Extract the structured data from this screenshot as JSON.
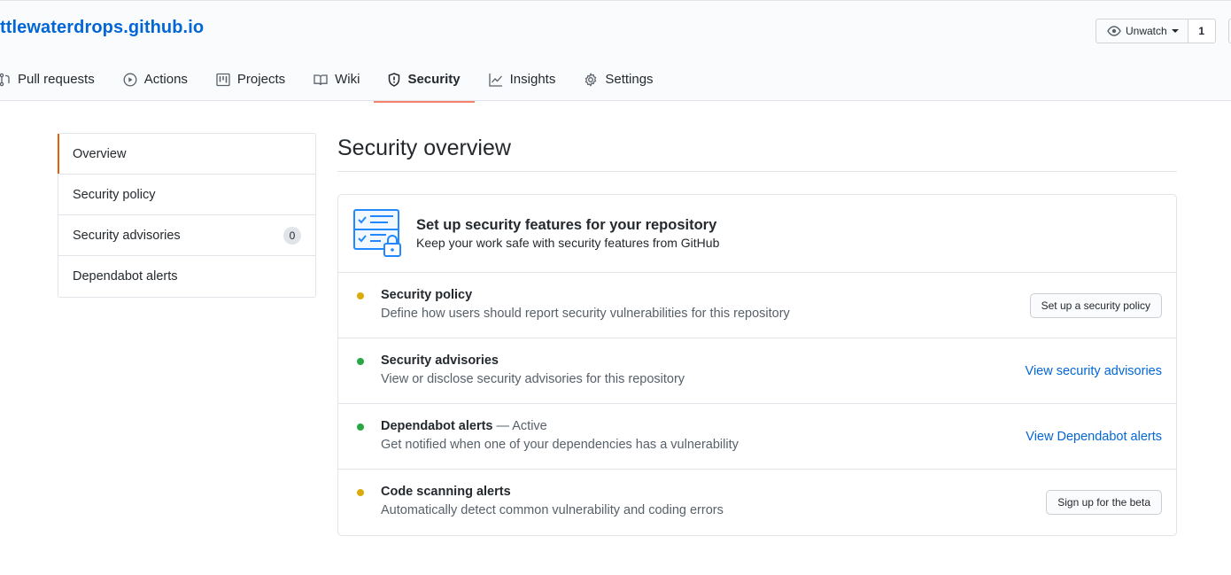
{
  "repo": {
    "title": "ttlewaterdrops.github.io"
  },
  "watch": {
    "label": "Unwatch",
    "count": "1"
  },
  "tabs": [
    {
      "label": "Pull requests",
      "icon": "pull-request-icon"
    },
    {
      "label": "Actions",
      "icon": "play-icon"
    },
    {
      "label": "Projects",
      "icon": "project-icon"
    },
    {
      "label": "Wiki",
      "icon": "book-icon"
    },
    {
      "label": "Security",
      "icon": "shield-icon",
      "selected": true
    },
    {
      "label": "Insights",
      "icon": "graph-icon"
    },
    {
      "label": "Settings",
      "icon": "gear-icon"
    }
  ],
  "sidebar": {
    "items": [
      {
        "label": "Overview",
        "selected": true
      },
      {
        "label": "Security policy"
      },
      {
        "label": "Security advisories",
        "count": "0"
      },
      {
        "label": "Dependabot alerts"
      }
    ]
  },
  "main": {
    "title": "Security overview",
    "card": {
      "heading": "Set up security features for your repository",
      "subheading": "Keep your work safe with security features from GitHub",
      "rows": [
        {
          "title": "Security policy",
          "status": "",
          "description": "Define how users should report security vulnerabilities for this repository",
          "dot_color": "#dbab09",
          "action": "Set up a security policy",
          "action_type": "button"
        },
        {
          "title": "Security advisories",
          "status": "",
          "description": "View or disclose security advisories for this repository",
          "dot_color": "#28a745",
          "action": "View security advisories",
          "action_type": "link"
        },
        {
          "title": "Dependabot alerts",
          "status": " — Active",
          "description": "Get notified when one of your dependencies has a vulnerability",
          "dot_color": "#28a745",
          "action": "View Dependabot alerts",
          "action_type": "link"
        },
        {
          "title": "Code scanning alerts",
          "status": "",
          "description": "Automatically detect common vulnerability and coding errors",
          "dot_color": "#dbab09",
          "action": "Sign up for the beta",
          "action_type": "button"
        }
      ]
    }
  },
  "colors": {
    "accent": "#0366d6",
    "tab_underline": "#f9826c",
    "warning_dot": "#dbab09",
    "success_dot": "#28a745"
  }
}
